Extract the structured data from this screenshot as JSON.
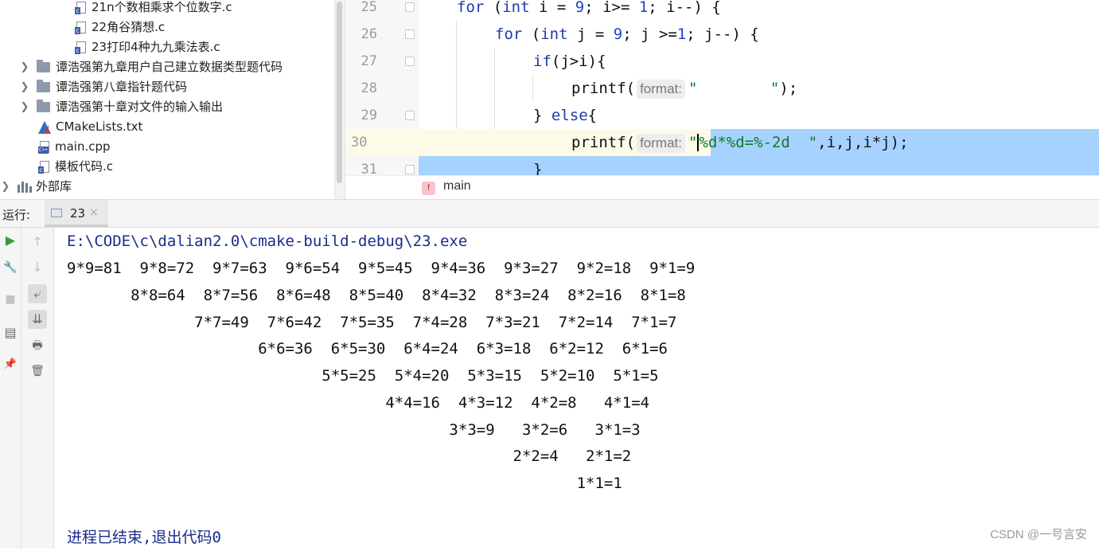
{
  "project_tree": {
    "items": [
      {
        "label": "21n个数相乘求个位数字.c",
        "type": "c"
      },
      {
        "label": "22角谷猜想.c",
        "type": "c"
      },
      {
        "label": "23打印4种九九乘法表.c",
        "type": "c"
      },
      {
        "label": "谭浩强第九章用户自己建立数据类型题代码",
        "type": "folder"
      },
      {
        "label": "谭浩强第八章指针题代码",
        "type": "folder"
      },
      {
        "label": "谭浩强第十章对文件的输入输出",
        "type": "folder"
      },
      {
        "label": "CMakeLists.txt",
        "type": "cmake"
      },
      {
        "label": "main.cpp",
        "type": "cpp"
      },
      {
        "label": "模板代码.c",
        "type": "c"
      },
      {
        "label": "外部库",
        "type": "libs"
      }
    ],
    "c_icon_letter": "c",
    "cpp_icon_letter": "C++"
  },
  "editor": {
    "line_numbers": [
      "25",
      "26",
      "27",
      "28",
      "29",
      "30",
      "31"
    ],
    "inlay_hint": "format:",
    "lines": {
      "l25": {
        "kw_for": "for",
        "p1": " (",
        "kw_int": "int",
        "p2": " i = ",
        "n1": "9",
        "p3": "; i>= ",
        "n2": "1",
        "p4": "; i--) {"
      },
      "l26": {
        "kw_for": "for",
        "p1": " (",
        "kw_int": "int",
        "p2": " j = ",
        "n1": "9",
        "p3": "; j >=",
        "n2": "1",
        "p4": "; j--) {"
      },
      "l27": {
        "kw_if": "if",
        "rest": "(j>i){"
      },
      "l28": {
        "fn": "printf(",
        "str": "\"        \"",
        "rest": ");"
      },
      "l29": {
        "brace": "} ",
        "kw_else": "else",
        "rest": "{"
      },
      "l30": {
        "fn": "printf(",
        "quote": "\"",
        "str": "%d*%d=%-2d  \"",
        "rest": ",i,j,i*j);"
      },
      "l31": {
        "brace": "}"
      }
    },
    "breadcrumb_badge": "f",
    "breadcrumb": "main"
  },
  "run_panel": {
    "label": "运行:",
    "tab_name": "23",
    "tab_close": "×"
  },
  "toolbar": {
    "run": "▶",
    "wrench": "🔧",
    "stop": "■",
    "layout": "▤",
    "pin": "📌",
    "up": "↑",
    "down": "↓",
    "wrap": "⤶",
    "scroll_end": "⇊",
    "print": "🖶",
    "trash": "🗑"
  },
  "console": {
    "path": "E:\\CODE\\c\\dalian2.0\\cmake-build-debug\\23.exe",
    "rows": [
      "9*9=81  9*8=72  9*7=63  9*6=54  9*5=45  9*4=36  9*3=27  9*2=18  9*1=9",
      "       8*8=64  8*7=56  8*6=48  8*5=40  8*4=32  8*3=24  8*2=16  8*1=8",
      "              7*7=49  7*6=42  7*5=35  7*4=28  7*3=21  7*2=14  7*1=7",
      "                     6*6=36  6*5=30  6*4=24  6*3=18  6*2=12  6*1=6",
      "                            5*5=25  5*4=20  5*3=15  5*2=10  5*1=5",
      "                                   4*4=16  4*3=12  4*2=8   4*1=4",
      "                                          3*3=9   3*2=6   3*1=3",
      "                                                 2*2=4   2*1=2",
      "                                                        1*1=1"
    ],
    "exit_message": "进程已结束,退出代码0"
  },
  "watermark": "CSDN @一号言安"
}
